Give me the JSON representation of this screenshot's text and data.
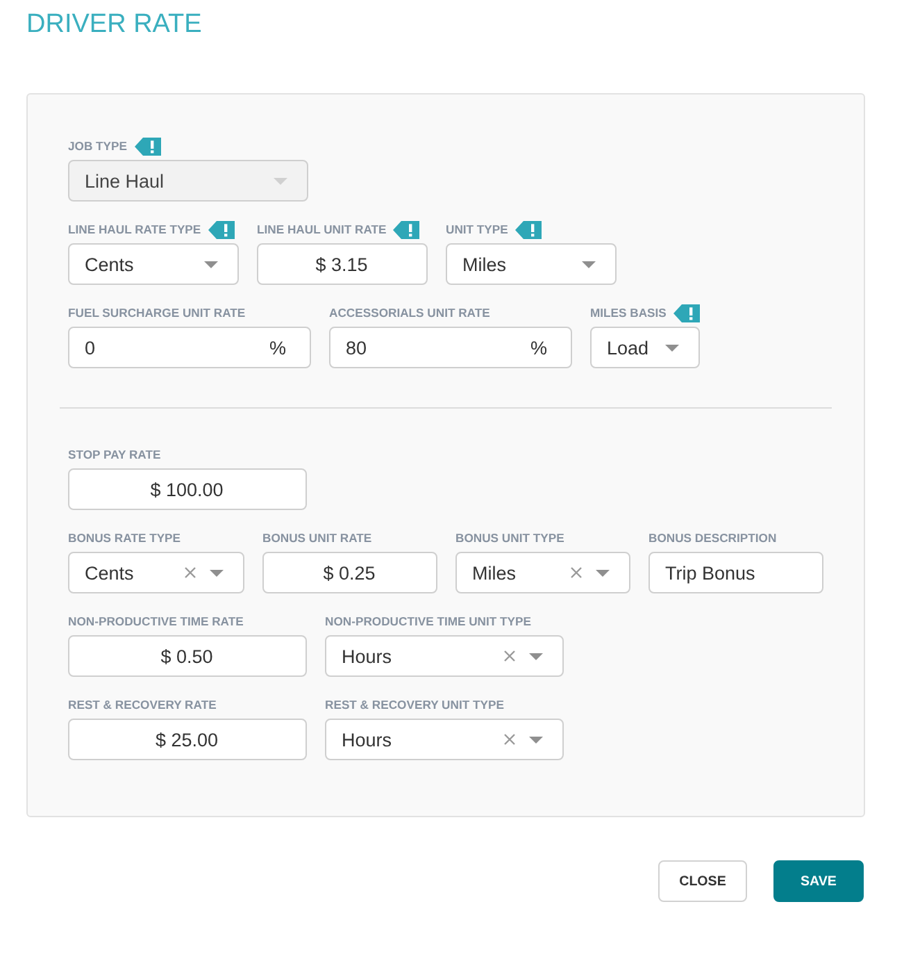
{
  "title": "DRIVER RATE",
  "sections": [
    {
      "rows": [
        {
          "fields": [
            {
              "label": "JOB TYPE",
              "kind": "select",
              "value": "Line Haul",
              "flag": true,
              "clearable": false,
              "disabled": true
            }
          ]
        },
        {
          "fields": [
            {
              "label": "LINE HAUL RATE TYPE",
              "kind": "select",
              "value": "Cents",
              "flag": true,
              "clearable": false,
              "disabled": false
            },
            {
              "label": "LINE HAUL UNIT RATE",
              "kind": "amount",
              "value": "$ 3.15",
              "flag": true,
              "clearable": false,
              "disabled": false
            },
            {
              "label": "UNIT TYPE",
              "kind": "select",
              "value": "Miles",
              "flag": true,
              "clearable": false,
              "disabled": false
            }
          ]
        },
        {
          "fields": [
            {
              "label": "FUEL SURCHARGE UNIT RATE",
              "kind": "text",
              "value": "0",
              "suffix": "%",
              "flag": false,
              "clearable": false,
              "disabled": false
            },
            {
              "label": "ACCESSORIALS UNIT RATE",
              "kind": "text",
              "value": "80",
              "suffix": "%",
              "flag": false,
              "clearable": false,
              "disabled": false
            },
            {
              "label": "MILES BASIS",
              "kind": "select",
              "value": "Load",
              "flag": true,
              "clearable": false,
              "disabled": false
            }
          ]
        }
      ]
    },
    {
      "rows": [
        {
          "fields": [
            {
              "label": "STOP PAY RATE",
              "kind": "amount",
              "value": "$ 100.00",
              "flag": false,
              "clearable": false,
              "disabled": false
            }
          ]
        },
        {
          "fields": [
            {
              "label": "BONUS RATE TYPE",
              "kind": "select",
              "value": "Cents",
              "flag": false,
              "clearable": true,
              "disabled": false
            },
            {
              "label": "BONUS UNIT RATE",
              "kind": "amount",
              "value": "$ 0.25",
              "flag": false,
              "clearable": false,
              "disabled": false
            },
            {
              "label": "BONUS UNIT TYPE",
              "kind": "select",
              "value": "Miles",
              "flag": false,
              "clearable": true,
              "disabled": false
            },
            {
              "label": "BONUS DESCRIPTION",
              "kind": "text",
              "value": "Trip Bonus",
              "flag": false,
              "clearable": false,
              "disabled": false
            }
          ]
        },
        {
          "fields": [
            {
              "label": "NON-PRODUCTIVE TIME RATE",
              "kind": "amount",
              "value": "$ 0.50",
              "flag": false,
              "clearable": false,
              "disabled": false
            },
            {
              "label": "NON-PRODUCTIVE TIME UNIT TYPE",
              "kind": "select",
              "value": "Hours",
              "flag": false,
              "clearable": true,
              "disabled": false
            }
          ]
        },
        {
          "fields": [
            {
              "label": "REST & RECOVERY RATE",
              "kind": "amount",
              "value": "$ 25.00",
              "flag": false,
              "clearable": false,
              "disabled": false
            },
            {
              "label": "REST & RECOVERY UNIT TYPE",
              "kind": "select",
              "value": "Hours",
              "flag": false,
              "clearable": true,
              "disabled": false
            }
          ]
        }
      ]
    }
  ],
  "buttons": [
    {
      "label": "CLOSE",
      "kind": "secondary"
    },
    {
      "label": "SAVE",
      "kind": "primary"
    }
  ]
}
